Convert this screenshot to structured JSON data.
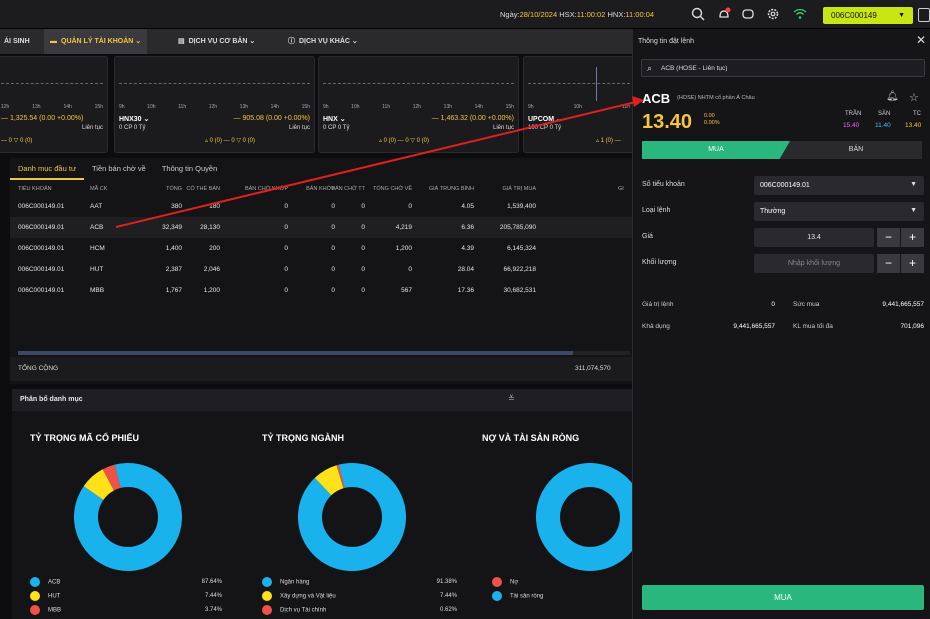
{
  "topbar": {
    "date_label": "Ngày:",
    "date": "28/10/2024",
    "hsx_label": "HSX:",
    "hsx_time": "11:00:02",
    "hnx_label": "HNX:",
    "hnx_time": "11:00:04",
    "account": "006C000149",
    "colors": {
      "accent": "#c8e614",
      "highlight": "#f4c542"
    }
  },
  "nav": {
    "items": [
      {
        "label": "ÁI SINH"
      },
      {
        "label": "QUẢN LÝ TÀI KHOẢN ⌄"
      },
      {
        "label": "DỊCH VỤ CƠ BẢN ⌄"
      },
      {
        "label": "DỊCH VỤ KHÁC ⌄"
      }
    ]
  },
  "indices": [
    {
      "name": "",
      "value": "— 1,325.54 (0.00 +0.00%)",
      "state": "Liên tục",
      "hours": [
        "12h",
        "13h",
        "14h",
        "15h"
      ],
      "vol": "",
      "breadth": "— 0   ▽ 0 (0)"
    },
    {
      "name": "HNX30 ⌄",
      "value": "— 905.08 (0.00 +0.00%)",
      "state": "Liên tục",
      "hours": [
        "9h",
        "10h",
        "11h",
        "12h",
        "13h",
        "14h",
        "15h"
      ],
      "vol": "0 CP  0 Tỷ",
      "breadth": "▵ 0 (0)   — 0   ▽ 0 (0)"
    },
    {
      "name": "HNX ⌄",
      "value": "— 1,463.32 (0.00 +0.00%)",
      "state": "Liên tục",
      "hours": [
        "9h",
        "10h",
        "11h",
        "12h",
        "13h",
        "14h",
        "15h"
      ],
      "vol": "0 CP  0 Tỷ",
      "breadth": "▵ 0 (0)   — 0   ▽ 0 (0)"
    },
    {
      "name": "UPCOM ⌄",
      "value": "",
      "state": "",
      "hours": [
        "9h",
        "10h",
        "11h"
      ],
      "vol": "100 CP  0 Tỷ",
      "breadth": "▵ 1 (0)   —"
    }
  ],
  "portfolio": {
    "tabs": [
      "Danh mục đầu tư",
      "Tiền bán chờ về",
      "Thông tin Quyền"
    ],
    "columns": [
      "TIỂU KHOẢN",
      "MÃ CK",
      "TỔNG",
      "CÓ THỂ BÁN",
      "BÁN CHỜ KHỚP",
      "BÁN KHỚP",
      "BÁN CHỜ TT",
      "TỔNG CHỜ VỀ",
      "GIÁ TRUNG BÌNH",
      "GIÁ TRỊ MUA",
      "GI"
    ],
    "rows": [
      [
        "006C000149.01",
        "AAT",
        "380",
        "180",
        "0",
        "0",
        "0",
        "0",
        "4.05",
        "1,539,400"
      ],
      [
        "006C000149.01",
        "ACB",
        "32,349",
        "28,130",
        "0",
        "0",
        "0",
        "4,219",
        "6.36",
        "205,785,090"
      ],
      [
        "006C000149.01",
        "HCM",
        "1,400",
        "200",
        "0",
        "0",
        "0",
        "1,200",
        "4.39",
        "6,145,324"
      ],
      [
        "006C000149.01",
        "HUT",
        "2,387",
        "2,046",
        "0",
        "0",
        "0",
        "0",
        "28.04",
        "66,922,218"
      ],
      [
        "006C000149.01",
        "MBB",
        "1,767",
        "1,200",
        "0",
        "0",
        "0",
        "567",
        "17.36",
        "30,682,531"
      ]
    ],
    "total_label": "TỔNG CỘNG",
    "total_value": "311,074,570"
  },
  "allocation": {
    "header": "Phân bổ danh mục",
    "stock_title": "TỶ TRỌNG MÃ CỔ PHIẾU",
    "sector_title": "TỶ TRỌNG NGÀNH",
    "netasset_title": "NỢ VÀ TÀI SẢN RÒNG",
    "stocks": [
      {
        "name": "ACB",
        "pct": "87.64%",
        "value": 87.64,
        "color": "#1ab2ec"
      },
      {
        "name": "HUT",
        "pct": "7.44%",
        "value": 7.44,
        "color": "#ffe11a"
      },
      {
        "name": "MBB",
        "pct": "3.74%",
        "value": 3.74,
        "color": "#f0524a"
      }
    ],
    "sectors": [
      {
        "name": "Ngân hàng",
        "pct": "91.38%",
        "value": 91.38,
        "color": "#1ab2ec"
      },
      {
        "name": "Xây dựng và Vật liệu",
        "pct": "7.44%",
        "value": 7.44,
        "color": "#ffe11a"
      },
      {
        "name": "Dịch vụ Tài chính",
        "pct": "0.62%",
        "value": 0.62,
        "color": "#f0524a"
      }
    ],
    "net": [
      {
        "name": "Nợ",
        "value": 0,
        "color": "#f0524a"
      },
      {
        "name": "Tài sản ròng",
        "value": 100,
        "color": "#1ab2ec"
      }
    ]
  },
  "order": {
    "title": "Thông tin đặt lệnh",
    "search": "ACB (HOSE - Liên tục)",
    "symbol": "ACB",
    "description": "(HOSE) NHTM cổ phần Á Châu",
    "price": "13.40",
    "change": "0.00",
    "change_pct": "0.00%",
    "ceiling_label": "TRẦN",
    "floor_label": "SÀN",
    "ref_label": "TC",
    "ceiling": "15.40",
    "floor": "11.40",
    "ref": "13.40",
    "buy_tab": "MUA",
    "sell_tab": "BÁN",
    "account_label": "Số tiểu khoản",
    "account_value": "006C000149.01",
    "type_label": "Loại lệnh",
    "type_value": "Thường",
    "price_label": "Giá",
    "price_value": "13.4",
    "qty_label": "Khối lượng",
    "qty_placeholder": "Nhập khối lượng",
    "order_value_label": "Giá trị lệnh",
    "order_value": "0",
    "buying_power_label": "Sức mua",
    "buying_power": "9,441,665,557",
    "available_label": "Khả dụng",
    "available": "9,441,665,557",
    "max_qty_label": "KL mua tối đa",
    "max_qty": "701,096",
    "submit": "MUA"
  }
}
